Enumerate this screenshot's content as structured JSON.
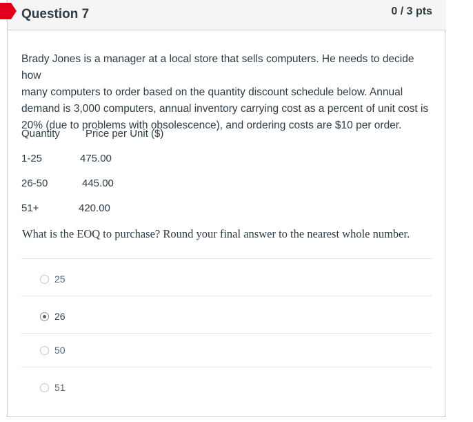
{
  "question": {
    "title": "Question 7",
    "points": "0 / 3 pts",
    "text_lines": [
      "Brady Jones is a manager at a local store that sells computers. He needs to decide how",
      "many computers to order based on the quantity discount schedule below. Annual",
      "demand is 3,000 computers, annual inventory carrying cost as a percent of unit cost is",
      "20% (due to problems with obsolescence), and ordering costs are $10 per order."
    ],
    "table": {
      "headers": [
        "Quantity",
        "Price per Unit ($)"
      ],
      "rows": [
        [
          "1-25",
          "475.00"
        ],
        [
          "26-50",
          "445.00"
        ],
        [
          "51+",
          "420.00"
        ]
      ]
    },
    "prompt": "What is the EOQ to purchase? Round your final answer to the nearest whole number."
  },
  "answers": [
    {
      "label": "25",
      "selected": false
    },
    {
      "label": "26",
      "selected": true
    },
    {
      "label": "50",
      "selected": false
    },
    {
      "label": "51",
      "selected": false
    }
  ],
  "colors": {
    "flag": "#e0001b",
    "header_bg": "#f5f5f5",
    "border": "#c7cdd1"
  }
}
